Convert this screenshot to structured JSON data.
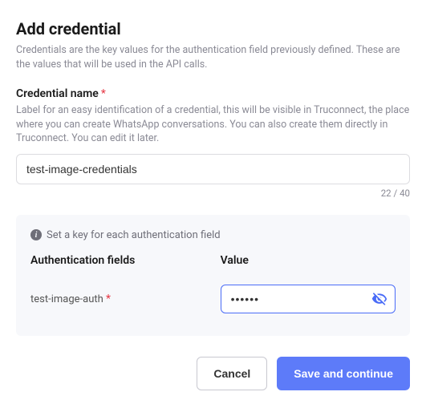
{
  "header": {
    "title": "Add credential",
    "subtitle": "Credentials are the key values for the authentication field previously defined. These are the values that will be used in the API calls."
  },
  "name_field": {
    "label": "Credential name",
    "required_mark": "*",
    "help": "Label for an easy identification of a credential, this will be visible in Truconnect, the place where you can create WhatsApp conversations. You can also create them directly in Truconnect. You can edit it later.",
    "value": "test-image-credentials",
    "counter": "22 / 40"
  },
  "auth_panel": {
    "info_text": "Set a key for each authentication field",
    "columns": {
      "fields_label": "Authentication fields",
      "value_label": "Value"
    },
    "rows": [
      {
        "name": "test-image-auth",
        "required_mark": "*",
        "value": "••••••"
      }
    ]
  },
  "buttons": {
    "cancel": "Cancel",
    "save": "Save and continue"
  }
}
